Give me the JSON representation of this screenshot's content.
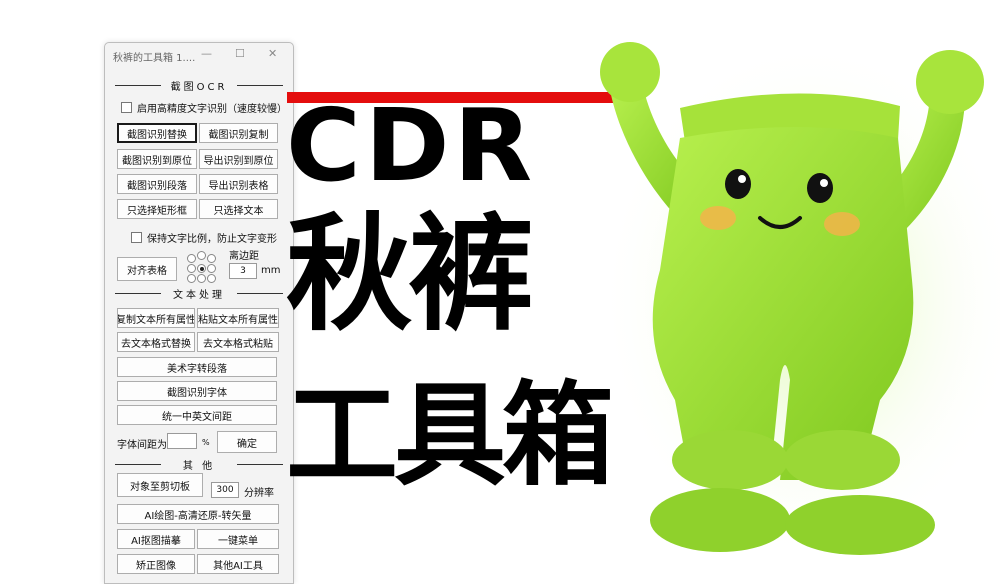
{
  "window": {
    "title": "秋裤的工具箱 1....",
    "controls": {
      "minimize": "—",
      "maximize": "☐",
      "close": "✕"
    }
  },
  "sections": {
    "ocr": "截图OCR",
    "text": "文本处理",
    "other": "其 他"
  },
  "ocr": {
    "high_precision_label": "启用高精度文字识别（速度较慢）",
    "buttons": [
      "截图识别替换",
      "截图识别复制",
      "截图识别到原位",
      "导出识别到原位",
      "截图识别段落",
      "导出识别表格",
      "只选择矩形框",
      "只选择文本"
    ],
    "keep_ratio_label": "保持文字比例，防止文字变形",
    "align_table_button": "对齐表格",
    "margin_label": "离边距",
    "margin_value": "3",
    "margin_unit": "mm"
  },
  "text_processing": {
    "buttons_pair_1": [
      "复制文本所有属性",
      "粘贴文本所有属性"
    ],
    "buttons_pair_2": [
      "去文本格式替换",
      "去文本格式粘贴"
    ],
    "art_text_button": "美术字转段落",
    "ocr_font_button": "截图识别字体",
    "unify_spacing_button": "统一中英文间距",
    "char_spacing_label": "字体间距为",
    "char_spacing_value": "",
    "percent": "%",
    "confirm_button": "确定"
  },
  "other": {
    "clipboard_button": "对象至剪切板",
    "resolution_value": "300",
    "resolution_label": "分辨率",
    "ai_redraw_button": "AI绘图-高清还原-转矢量",
    "ai_trace_button": "AI抠图描摹",
    "one_click_menu_button": "一键菜单",
    "correct_image_button": "矫正图像",
    "other_ai_button": "其他AI工具"
  },
  "headline": {
    "line1": "CDR",
    "line2": "秋裤",
    "line3": "工具箱"
  },
  "colors": {
    "red_bar": "#e40d0d",
    "mascot_green": "#9be03a"
  }
}
